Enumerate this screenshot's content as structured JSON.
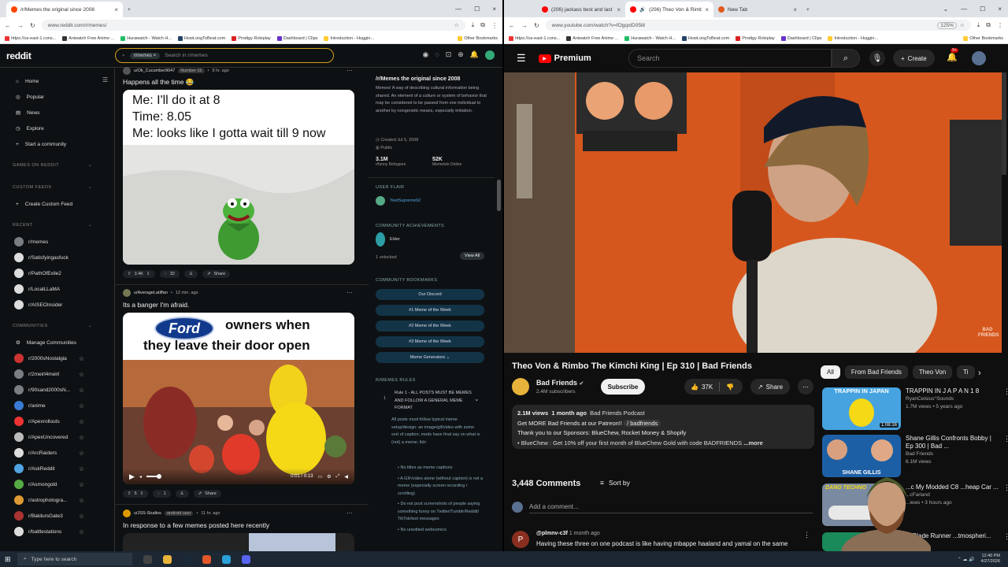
{
  "left_browser": {
    "tabs": [
      {
        "title": "/r/Memes the original since 2008",
        "active": true
      }
    ],
    "url": "www.reddit.com/r/memes/",
    "bookmarks": [
      "https://us-east-1.cons...",
      "Aniwatch Free Anime ...",
      "Hurawatch - Watch H...",
      "HowLongToBeat.com",
      "Prodigy Roleplay",
      "Dashboard | Clips",
      "Introduction - Huggin..."
    ],
    "other_bookmarks": "Other Bookmarks"
  },
  "right_browser": {
    "tabs": [
      {
        "title": "(206) jackass best and last | Of",
        "active": false
      },
      {
        "title": "(206) Theo Von & Rimbo Th",
        "active": true
      },
      {
        "title": "New Tab",
        "active": false
      }
    ],
    "url": "www.youtube.com/watch?v=fOgqxtD05l8",
    "zoom": "125%",
    "bookmarks": [
      "https://us-east-1.cons...",
      "Aniwatch Free Anime ...",
      "Hurawatch - Watch H...",
      "HowLongToBeat.com",
      "Prodigy Roleplay",
      "Dashboard | Clips",
      "Introduction - Huggin..."
    ],
    "other_bookmarks": "Other Bookmarks"
  },
  "reddit": {
    "logo": "reddit",
    "search_chip": "r/memes",
    "search_placeholder": "Search in r/memes",
    "nav": [
      {
        "label": "Home",
        "icon": "home-icon",
        "g": "⌂"
      },
      {
        "label": "Popular",
        "icon": "popular-icon",
        "g": "◎"
      },
      {
        "label": "News",
        "icon": "news-icon",
        "g": "▤"
      },
      {
        "label": "Explore",
        "icon": "explore-icon",
        "g": "◷"
      },
      {
        "label": "Start a community",
        "icon": "plus-icon",
        "g": "+"
      }
    ],
    "games_header": "GAMES ON REDDIT",
    "custom_header": "CUSTOM FEEDS",
    "create_feed": "Create Custom Feed",
    "recent_header": "RECENT",
    "recent": [
      {
        "name": "r/memes",
        "color": "#7a7f83"
      },
      {
        "name": "r/Satisfyingasfuck",
        "color": "#ddd"
      },
      {
        "name": "r/PathOfExile2",
        "color": "#ddd"
      },
      {
        "name": "r/LocalLLaMA",
        "color": "#ddd"
      },
      {
        "name": "r/AISEOInsider",
        "color": "#ddd"
      }
    ],
    "communities_header": "COMMUNITIES",
    "manage": "Manage Communities",
    "communities": [
      {
        "name": "r/2000sNostalgia",
        "color": "#c33"
      },
      {
        "name": "r/2meirl4meirl",
        "color": "#7a7f83"
      },
      {
        "name": "r/90sand2000sN...",
        "color": "#7a7f83"
      },
      {
        "name": "r/anime",
        "color": "#3a7bd5"
      },
      {
        "name": "r/Apexrollouts",
        "color": "#e33"
      },
      {
        "name": "r/ApexUncovered",
        "color": "#bbb"
      },
      {
        "name": "r/ArcRaiders",
        "color": "#ddd"
      },
      {
        "name": "r/AskReddit",
        "color": "#4fa3e0"
      },
      {
        "name": "r/Asmongold",
        "color": "#5a4"
      },
      {
        "name": "r/astrophotogra...",
        "color": "#d93"
      },
      {
        "name": "r/BaldursGate3",
        "color": "#a33"
      },
      {
        "name": "r/battlestations",
        "color": "#ddd"
      }
    ],
    "posts": [
      {
        "user": "u/Ok_Cucumber9047",
        "flair": "Number 15",
        "time": "8 hr. ago",
        "title": "Happens all the time 😂",
        "meme_lines": [
          "Me: I'll do it at 8",
          "Time: 8.05",
          "Me: looks like I gotta wait till 9 now"
        ],
        "votes": "3.4K",
        "comments": "32",
        "share": "Share"
      },
      {
        "user": "u/AverageLatiffan",
        "time": "12 min. ago",
        "title": "Its a banger I'm afraid.",
        "meme_brand": "Ford",
        "meme_text": "owners when",
        "meme_text2": "they leave their door open",
        "video_time": "0:01 / 0:13",
        "votes": "5",
        "comments": "1",
        "share": "Share"
      },
      {
        "user": "u/JSS-Studios",
        "flair": "android user",
        "time": "11 hr. ago",
        "title": "In response to a few memes posted here recently"
      }
    ],
    "sidebar": {
      "title": "/r/Memes the original since 2008",
      "desc": "Memes! A way of describing cultural information being shared. An element of a culture or system of behavior that may be considered to be passed from one individual to another by nongenetic means, especially imitation.",
      "created": "Created Jul 5, 2008",
      "visibility": "Public",
      "members": "3.1M",
      "members_label": "r/funny Refugees",
      "online": "52K",
      "online_label": "Memeists Online",
      "user_flair_header": "USER FLAIR",
      "flair_user": "YeetSupreme92",
      "achievements_header": "COMMUNITY ACHIEVEMENTS",
      "achievement": "Elder",
      "unlocked": "1 unlocked",
      "view_all": "View All",
      "bookmarks_header": "COMMUNITY BOOKMARKS",
      "bookmarks": [
        "Our Discord",
        "#1 Meme of the Week",
        "#2 Meme of the Week",
        "#3 Meme of the Week",
        "Meme Generators"
      ],
      "rules_header": "R/MEMES RULES",
      "rule_num": "1",
      "rule": "Rule 1 - ALL POSTS MUST BE MEMES AND FOLLOW A GENERAL MEME FORMAT",
      "rule_text": "All posts must follow typical meme setup/design: an image/gif/video with some sort of caption; mods have final say on what is (not) a meme; tldr:",
      "rule_bullets": [
        "No titles as meme captions",
        "A GIF/video alone (without caption) is not a meme (especially screen recording / scrolling)",
        "Do not post screenshots of people saying something funny on Twitter/Tumblr/Reddit/ TikTok/text messages",
        "No unedited webcomics"
      ]
    }
  },
  "youtube": {
    "brand": "Premium",
    "search_placeholder": "Search",
    "create": "Create",
    "notif_count": "9+",
    "video_watermark": "BAD FRIENDS",
    "title": "Theo Von & Rimbo The Kimchi King | Ep 310 | Bad Friends",
    "channel": "Bad Friends",
    "subs": "2.4M subscribers",
    "subscribe": "Subscribe",
    "likes": "37K",
    "share": "Share",
    "views": "2.1M views",
    "age": "1 month ago",
    "podcast": "Bad Friends Podcast",
    "desc1": "Get MORE Bad Friends at our Patreon!!",
    "desc1_link": "/ badfriends",
    "desc2": "Thank you to our Sponsors: BlueChew, Rocket Money & Shopify",
    "desc3": "• BlueChew : Get 10% off your first month of BlueChew Gold with code BADFRIENDS",
    "more": "...more",
    "chips": [
      "All",
      "From Bad Friends",
      "Theo Von",
      "Ti"
    ],
    "comments_count": "3,448 Comments",
    "sort": "Sort by",
    "add_comment": "Add a comment...",
    "comment_user": "@plmnv-c3f",
    "comment_time": "1 month ago",
    "comment_text": "Having these three on one podcast is like having mbappe haaland and yamal on the same",
    "related": [
      {
        "title": "TRAPPIN IN J A P A N 1 8",
        "channel": "RyanCelsius°Sounds",
        "meta": "1.7M views • 5 years ago",
        "duration": "1:08:16",
        "thumb_text": "TRAPPIN IN JAPAN"
      },
      {
        "title": "Shane Gillis Confronts Bobby | Ep 300 | Bad ...",
        "channel": "Bad Friends",
        "meta": "6.1M views",
        "thumb_text": "SHANE GILLIS"
      },
      {
        "title": "...c My Modded C8 ...heap Car ...",
        "channel": "...cFarland",
        "meta": "...iews • 3 hours ago",
        "thumb_text": "DANG TECHNO"
      },
      {
        "title": "... Blade Runner ...tmospheri...",
        "channel": "",
        "meta": "",
        "thumb_text": ""
      }
    ]
  },
  "taskbar": {
    "search_placeholder": "Type here to search",
    "time": "12:40 PM",
    "date": "4/27/2026"
  }
}
